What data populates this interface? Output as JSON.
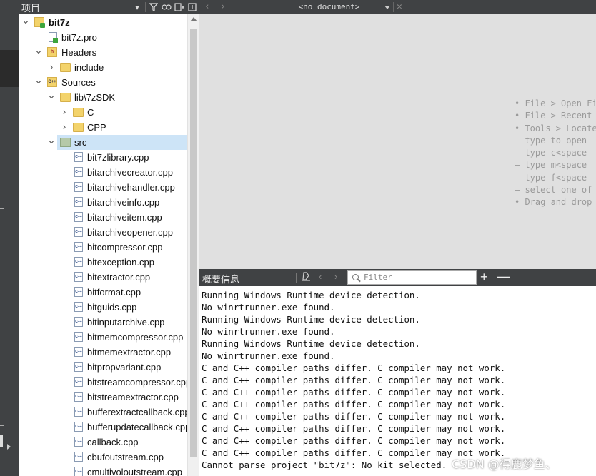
{
  "project_panel": {
    "title": "项目",
    "tree": [
      {
        "label": "bit7z",
        "kind": "project-root",
        "depth": 0,
        "expanded": true,
        "bold": true
      },
      {
        "label": "bit7z.pro",
        "kind": "pro-file",
        "depth": 1
      },
      {
        "label": "Headers",
        "kind": "headers",
        "depth": 1,
        "expanded": true
      },
      {
        "label": "include",
        "kind": "folder",
        "depth": 2,
        "expanded": false
      },
      {
        "label": "Sources",
        "kind": "sources",
        "depth": 1,
        "expanded": true
      },
      {
        "label": "lib\\7zSDK",
        "kind": "folder",
        "depth": 2,
        "expanded": true
      },
      {
        "label": "C",
        "kind": "folder",
        "depth": 3,
        "expanded": false
      },
      {
        "label": "CPP",
        "kind": "folder",
        "depth": 3,
        "expanded": false
      },
      {
        "label": "src",
        "kind": "folder-green",
        "depth": 2,
        "expanded": true,
        "selected": true
      },
      {
        "label": "bit7zlibrary.cpp",
        "kind": "cpp",
        "depth": 3
      },
      {
        "label": "bitarchivecreator.cpp",
        "kind": "cpp",
        "depth": 3
      },
      {
        "label": "bitarchivehandler.cpp",
        "kind": "cpp",
        "depth": 3
      },
      {
        "label": "bitarchiveinfo.cpp",
        "kind": "cpp",
        "depth": 3
      },
      {
        "label": "bitarchiveitem.cpp",
        "kind": "cpp",
        "depth": 3
      },
      {
        "label": "bitarchiveopener.cpp",
        "kind": "cpp",
        "depth": 3
      },
      {
        "label": "bitcompressor.cpp",
        "kind": "cpp",
        "depth": 3
      },
      {
        "label": "bitexception.cpp",
        "kind": "cpp",
        "depth": 3
      },
      {
        "label": "bitextractor.cpp",
        "kind": "cpp",
        "depth": 3
      },
      {
        "label": "bitformat.cpp",
        "kind": "cpp",
        "depth": 3
      },
      {
        "label": "bitguids.cpp",
        "kind": "cpp",
        "depth": 3
      },
      {
        "label": "bitinputarchive.cpp",
        "kind": "cpp",
        "depth": 3
      },
      {
        "label": "bitmemcompressor.cpp",
        "kind": "cpp",
        "depth": 3
      },
      {
        "label": "bitmemextractor.cpp",
        "kind": "cpp",
        "depth": 3
      },
      {
        "label": "bitpropvariant.cpp",
        "kind": "cpp",
        "depth": 3
      },
      {
        "label": "bitstreamcompressor.cpp",
        "kind": "cpp",
        "depth": 3
      },
      {
        "label": "bitstreamextractor.cpp",
        "kind": "cpp",
        "depth": 3
      },
      {
        "label": "bufferextractcallback.cpp",
        "kind": "cpp",
        "depth": 3
      },
      {
        "label": "bufferupdatecallback.cpp",
        "kind": "cpp",
        "depth": 3
      },
      {
        "label": "callback.cpp",
        "kind": "cpp",
        "depth": 3
      },
      {
        "label": "cbufoutstream.cpp",
        "kind": "cpp",
        "depth": 3
      },
      {
        "label": "cmultivoloutstream.cpp",
        "kind": "cpp",
        "depth": 3
      }
    ]
  },
  "editor": {
    "document_label": "<no document>",
    "hints": [
      {
        "text": "• File > Open Fi"
      },
      {
        "text": "• File > Recent F"
      },
      {
        "text": "• Tools > Locate"
      },
      {
        "text": "  – type to open"
      },
      {
        "text": "  – type c<space"
      },
      {
        "text": "  – type m<space"
      },
      {
        "text": "  – type f<space"
      },
      {
        "text": "  – select one of"
      },
      {
        "text": "• Drag and drop t"
      }
    ]
  },
  "output_pane": {
    "title": "概要信息",
    "filter_placeholder": "Filter",
    "lines": [
      "Running Windows Runtime device detection.",
      "No winrtrunner.exe found.",
      "Running Windows Runtime device detection.",
      "No winrtrunner.exe found.",
      "Running Windows Runtime device detection.",
      "No winrtrunner.exe found.",
      "C and C++ compiler paths differ. C compiler may not work.",
      "C and C++ compiler paths differ. C compiler may not work.",
      "C and C++ compiler paths differ. C compiler may not work.",
      "C and C++ compiler paths differ. C compiler may not work.",
      "C and C++ compiler paths differ. C compiler may not work.",
      "C and C++ compiler paths differ. C compiler may not work.",
      "C and C++ compiler paths differ. C compiler may not work.",
      "C and C++ compiler paths differ. C compiler may not work.",
      "Cannot parse project \"bit7z\": No kit selected."
    ]
  },
  "watermark": "CSDN @得鹿梦鱼、"
}
